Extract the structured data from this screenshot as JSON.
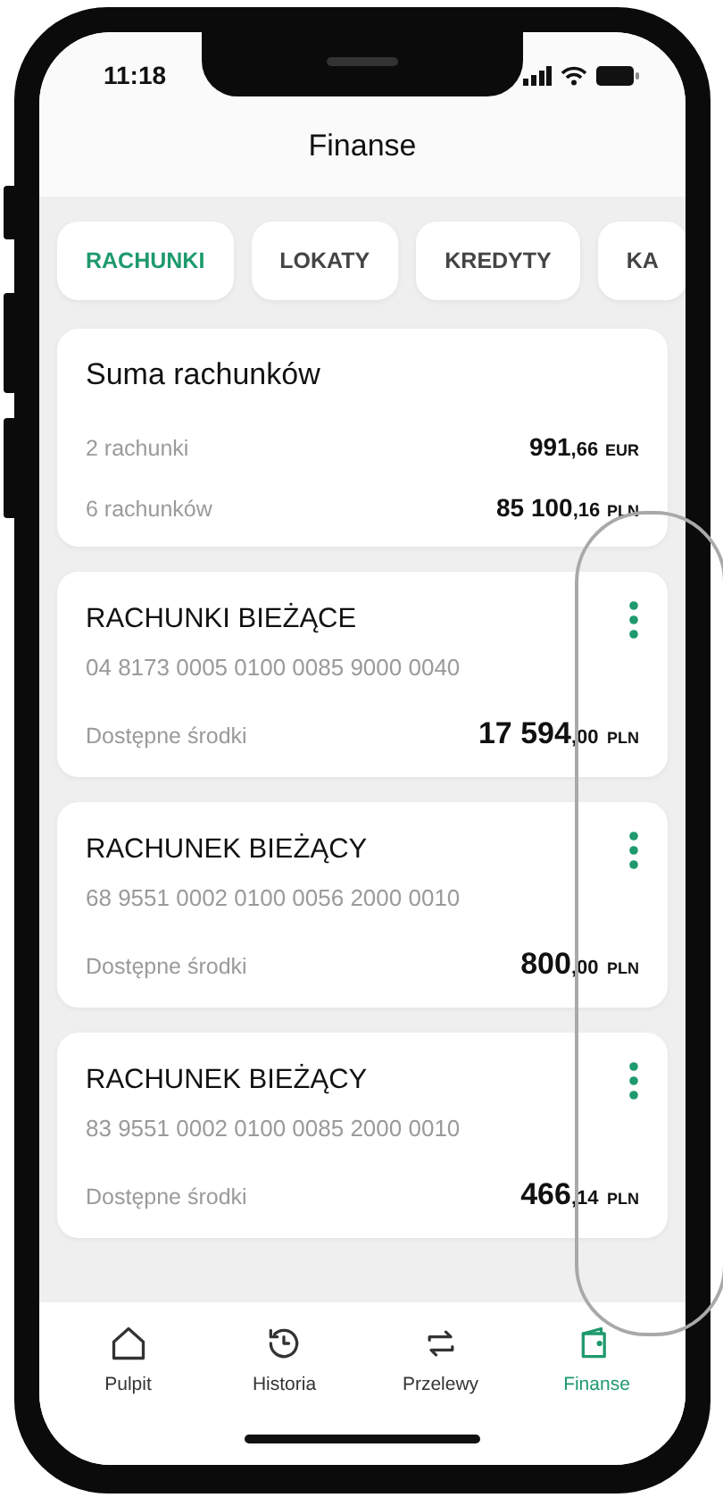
{
  "status_bar": {
    "time": "11:18"
  },
  "header": {
    "title": "Finanse"
  },
  "tabs": [
    {
      "label": "RACHUNKI",
      "selected": true
    },
    {
      "label": "LOKATY",
      "selected": false
    },
    {
      "label": "KREDYTY",
      "selected": false
    },
    {
      "label": "KA",
      "selected": false
    }
  ],
  "summary": {
    "title": "Suma rachunków",
    "rows": [
      {
        "label": "2 rachunki",
        "amount": "991",
        "decimals": ",66",
        "currency": "EUR"
      },
      {
        "label": "6 rachunków",
        "amount": "85 100",
        "decimals": ",16",
        "currency": "PLN"
      }
    ]
  },
  "accounts": [
    {
      "name": "RACHUNKI BIEŻĄCE",
      "number": "04 8173 0005 0100 0085 9000 0040",
      "balance_label": "Dostępne środki",
      "amount": "17 594",
      "decimals": ",00",
      "currency": "PLN"
    },
    {
      "name": "RACHUNEK BIEŻĄCY",
      "number": "68 9551 0002 0100 0056 2000 0010",
      "balance_label": "Dostępne środki",
      "amount": "800",
      "decimals": ",00",
      "currency": "PLN"
    },
    {
      "name": "RACHUNEK BIEŻĄCY",
      "number": "83 9551 0002 0100 0085 2000 0010",
      "balance_label": "Dostępne środki",
      "amount": "466",
      "decimals": ",14",
      "currency": "PLN"
    }
  ],
  "nav": [
    {
      "kind": "home",
      "label": "Pulpit",
      "selected": false
    },
    {
      "kind": "history",
      "label": "Historia",
      "selected": false
    },
    {
      "kind": "transfer",
      "label": "Przelewy",
      "selected": false
    },
    {
      "kind": "wallet",
      "label": "Finanse",
      "selected": true
    }
  ]
}
